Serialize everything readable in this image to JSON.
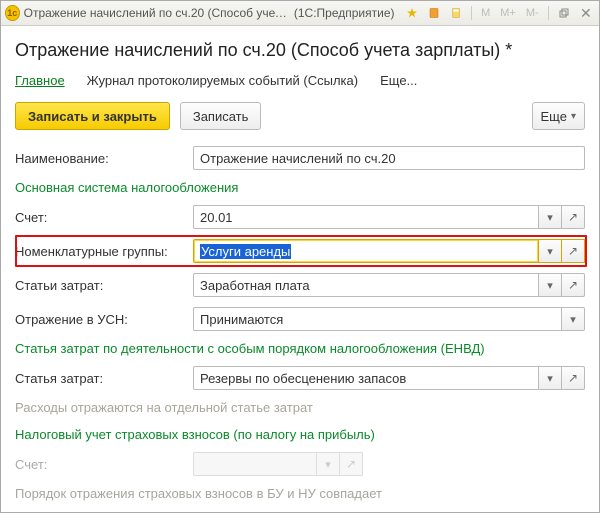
{
  "titlebar": {
    "title": "Отражение начислений по сч.20 (Способ учета зар...",
    "platform": "(1С:Предприятие)",
    "m_buttons": [
      "M",
      "M+",
      "M-"
    ]
  },
  "page": {
    "title": "Отражение начислений по сч.20 (Способ учета зарплаты) *"
  },
  "tabs": {
    "main": "Главное",
    "journal": "Журнал протоколируемых событий (Ссылка)",
    "more": "Еще..."
  },
  "toolbar": {
    "save_close": "Записать и закрыть",
    "save": "Записать",
    "more": "Еще"
  },
  "labels": {
    "name": "Наименование:",
    "section_main_tax": "Основная система налогообложения",
    "account": "Счет:",
    "nomen_groups": "Номенклатурные группы:",
    "cost_items": "Статьи затрат:",
    "usn_reflection": "Отражение в УСН:",
    "section_envd": "Статья затрат по деятельности с особым порядком налогообложения (ЕНВД)",
    "cost_item_single": "Статья затрат:",
    "note_sep_article": "Расходы отражаются на отдельной статье затрат",
    "section_insurance": "Налоговый учет страховых взносов (по налогу на прибыль)",
    "account2": "Счет:",
    "note_accounting_match": "Порядок отражения страховых взносов в БУ и НУ совпадает"
  },
  "values": {
    "name": "Отражение начислений по сч.20",
    "account": "20.01",
    "nomen_groups": "Услуги аренды",
    "cost_items": "Заработная плата",
    "usn_reflection": "Принимаются",
    "cost_item_single": "Резервы по обесценению запасов",
    "account2": ""
  }
}
